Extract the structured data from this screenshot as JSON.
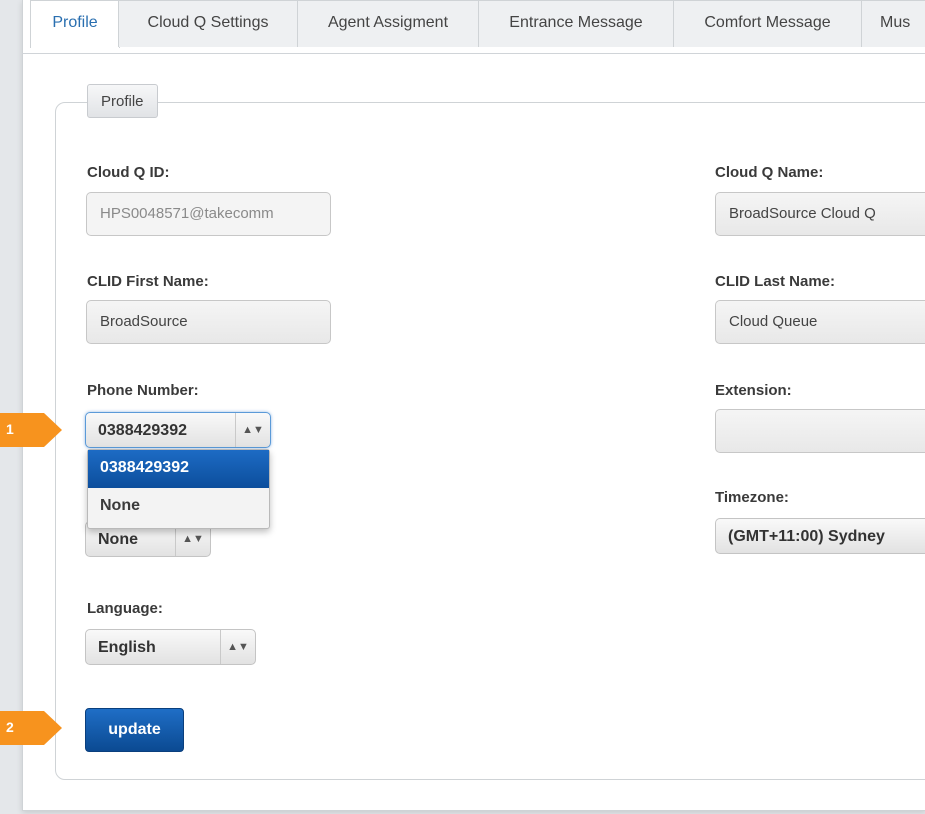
{
  "tabs": [
    {
      "label": "Profile"
    },
    {
      "label": "Cloud Q Settings"
    },
    {
      "label": "Agent Assigment"
    },
    {
      "label": "Entrance Message"
    },
    {
      "label": "Comfort Message"
    },
    {
      "label": "Mus"
    }
  ],
  "section": {
    "legend": "Profile"
  },
  "fields": {
    "cloud_q_id": {
      "label": "Cloud Q ID:",
      "value": "HPS0048571@takecomm"
    },
    "cloud_q_name": {
      "label": "Cloud Q Name:",
      "value": "BroadSource Cloud Q"
    },
    "clid_first": {
      "label": "CLID First Name:",
      "value": "BroadSource"
    },
    "clid_last": {
      "label": "CLID Last Name:",
      "value": "Cloud Queue"
    },
    "phone": {
      "label": "Phone Number:",
      "value": "0388429392",
      "options": [
        "0388429392",
        "None"
      ]
    },
    "extension": {
      "label": "Extension:",
      "value": ""
    },
    "hidden_select": {
      "value": "None"
    },
    "timezone": {
      "label": "Timezone:",
      "value": "(GMT+11:00) Sydney"
    },
    "language": {
      "label": "Language:",
      "value": "English"
    }
  },
  "update_label": "update",
  "callouts": [
    "1",
    "2"
  ],
  "colors": {
    "accent": "#0d4f9e",
    "callout": "#f7931e",
    "tab_active_text": "#2a6fb0"
  }
}
